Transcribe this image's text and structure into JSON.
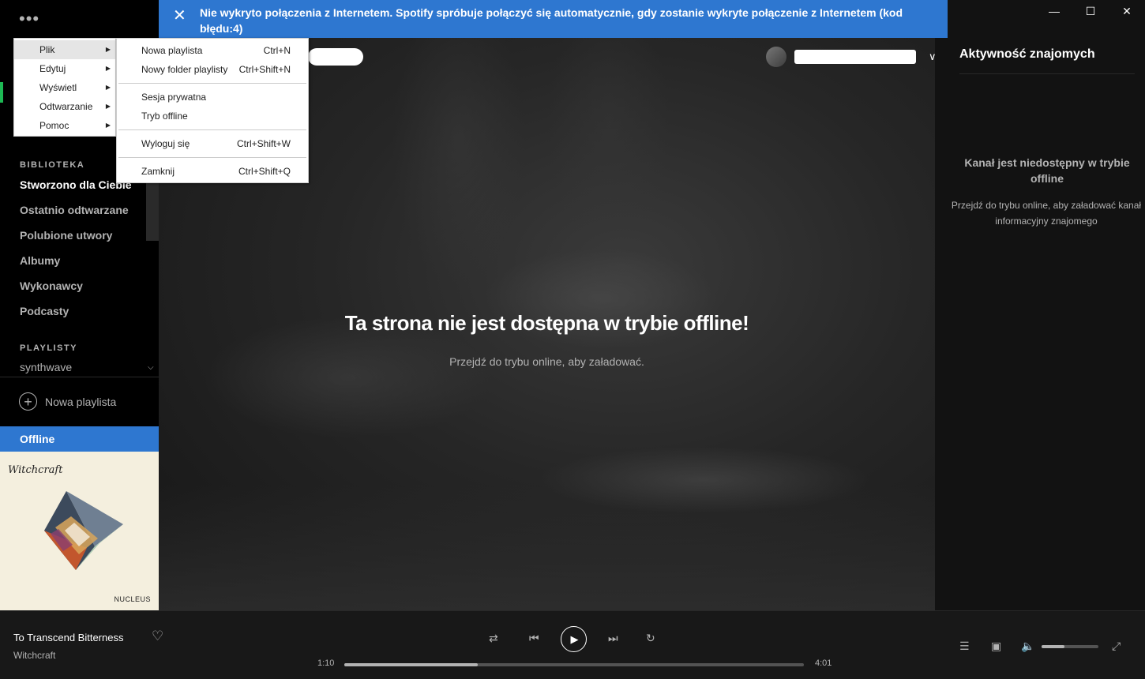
{
  "banner": {
    "message": "Nie wykryto połączenia z Internetem. Spotify spróbuje połączyć się automatycznie, gdy zostanie wykryte połączenie z Internetem (kod błędu:4)"
  },
  "sidebar": {
    "dots": "•••",
    "library_title": "BIBLIOTEKA",
    "library_items": [
      "Stworzono dla Ciebie",
      "Ostatnio odtwarzane",
      "Polubione utwory",
      "Albumy",
      "Wykonawcy",
      "Podcasty"
    ],
    "playlists_title": "PLAYLISTY",
    "playlist": "synthwave",
    "new_playlist": "Nowa playlista",
    "offline_label": "Offline",
    "cover_logo": "Witchcraft",
    "cover_title": "NUCLEUS"
  },
  "menu": {
    "main_items": [
      "Plik",
      "Edytuj",
      "Wyświetl",
      "Odtwarzanie",
      "Pomoc"
    ],
    "file_items": [
      {
        "label": "Nowa playlista",
        "shortcut": "Ctrl+N"
      },
      {
        "label": "Nowy folder playlisty",
        "shortcut": "Ctrl+Shift+N"
      },
      {
        "label": "Sesja prywatna",
        "shortcut": ""
      },
      {
        "label": "Tryb offline",
        "shortcut": ""
      },
      {
        "label": "Wyloguj się",
        "shortcut": "Ctrl+Shift+W"
      },
      {
        "label": "Zamknij",
        "shortcut": "Ctrl+Shift+Q"
      }
    ]
  },
  "main": {
    "offline_title": "Ta strona nie jest dostępna w trybie offline!",
    "offline_sub": "Przejdź do trybu online, aby załadować."
  },
  "friends": {
    "title": "Aktywność znajomych",
    "unavailable": "Kanał jest niedostępny w trybie offline",
    "sub": "Przejdź do trybu online, aby załadować kanał informacyjny znajomego"
  },
  "player": {
    "track": "To Transcend Bitterness",
    "artist": "Witchcraft",
    "elapsed": "1:10",
    "duration": "4:01",
    "progress_fraction": 0.29,
    "volume_fraction": 0.4
  },
  "colors": {
    "accent_blue": "#2e77d0",
    "green": "#1db954",
    "bg": "#121212"
  }
}
